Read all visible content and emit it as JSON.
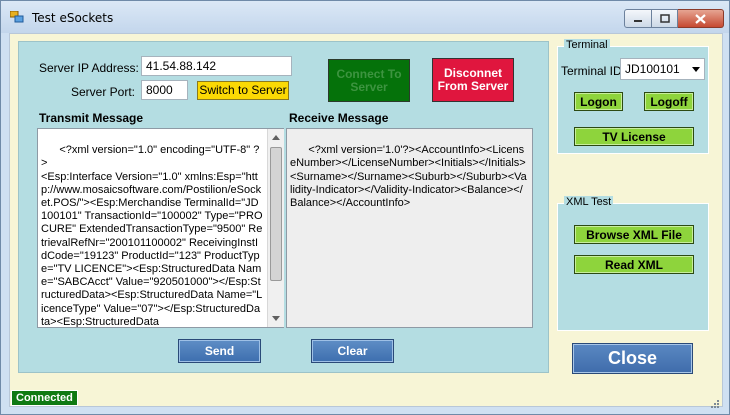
{
  "window": {
    "title": "Test eSockets",
    "icons": {
      "app": "app-window-icon",
      "minimize": "minimize-icon",
      "maximize": "maximize-icon",
      "close": "close-x-icon"
    }
  },
  "server": {
    "ip_label": "Server IP Address:",
    "ip_value": "41.54.88.142",
    "port_label": "Server Port:",
    "port_value": "8000",
    "switch_label": "Switch to Server",
    "connect_label": "Connect To Server",
    "disconnect_label": "Disconnet From Server"
  },
  "transmit": {
    "title": "Transmit Message",
    "text": "<?xml version=\"1.0\" encoding=\"UTF-8\" ?>\n<Esp:Interface Version=\"1.0\" xmlns:Esp=\"http://www.mosaicsoftware.com/Postilion/eSocket.POS/\"><Esp:Merchandise TerminalId=\"JD100101\" TransactionId=\"100002\" Type=\"PROCURE\" ExtendedTransactionType=\"9500\" RetrievalRefNr=\"200101100002\" ReceivingInstIdCode=\"19123\" ProductId=\"123\" ProductType=\"TV LICENCE\"><Esp:StructuredData Name=\"SABCAcct\" Value=\"920501000\"></Esp:StructuredData><Esp:StructuredData Name=\"LicenceType\" Value=\"07\"></Esp:StructuredData><Esp:StructuredData"
  },
  "receive": {
    "title": "Receive Message",
    "text": "<?xml version='1.0'?><AccountInfo><LicenseNumber></LicenseNumber><Initials></Initials><Surname></Surname><Suburb></Suburb><Validity-Indicator></Validity-Indicator><Balance></Balance></AccountInfo>"
  },
  "actions": {
    "send_label": "Send",
    "clear_label": "Clear"
  },
  "terminal": {
    "group_title": "Terminal",
    "id_label": "Terminal ID:",
    "id_value": "JD100101",
    "logon_label": "Logon",
    "logoff_label": "Logoff",
    "tv_license_label": "TV License"
  },
  "xml_test": {
    "group_title": "XML Test",
    "browse_label": "Browse XML File",
    "read_label": "Read XML"
  },
  "close_label": "Close",
  "status": {
    "text": "Connected"
  },
  "colors": {
    "panel": "#b4dde2",
    "client": "#f7f5d6",
    "connect_green": "#05720a",
    "disconnect_red": "#e0163e",
    "switch_yellow": "#fbd904",
    "action_green": "#8ed43c",
    "action_blue": "#3d6eae",
    "status_green": "#0f7a13"
  }
}
